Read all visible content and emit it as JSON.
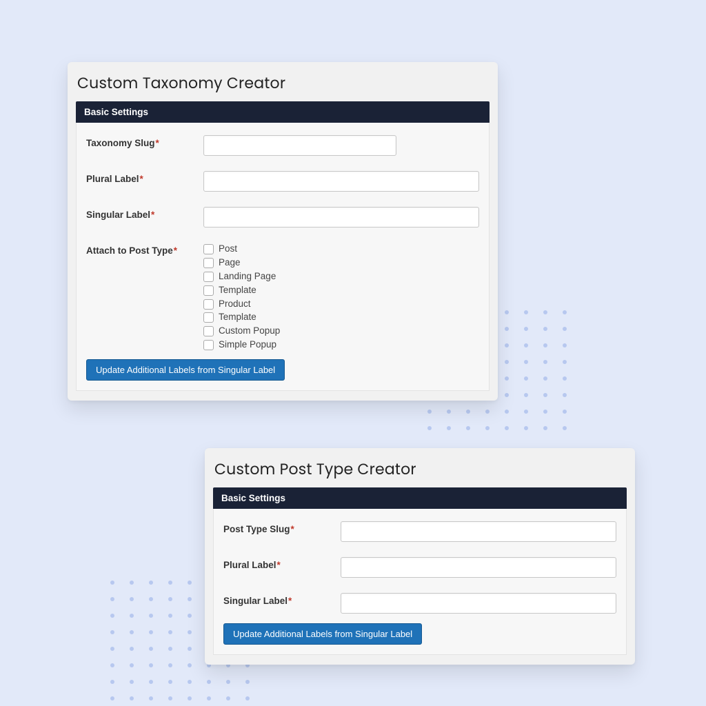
{
  "card1": {
    "title": "Custom Taxonomy Creator",
    "section": "Basic Settings",
    "fields": {
      "slug": "Taxonomy Slug",
      "plural": "Plural Label",
      "singular": "Singular Label",
      "attach": "Attach to Post Type"
    },
    "postTypes": [
      "Post",
      "Page",
      "Landing Page",
      "Template",
      "Product",
      "Template",
      "Custom Popup",
      "Simple Popup"
    ],
    "button": "Update Additional Labels from Singular Label"
  },
  "card2": {
    "title": "Custom Post Type Creator",
    "section": "Basic Settings",
    "fields": {
      "slug": "Post Type Slug",
      "plural": "Plural Label",
      "singular": "Singular Label"
    },
    "button": "Update Additional Labels from Singular Label"
  },
  "req": "*"
}
